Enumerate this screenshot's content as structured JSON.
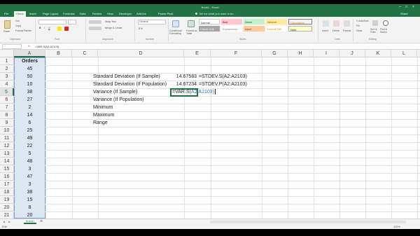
{
  "window": {
    "title": "Book1 - Excel"
  },
  "tabs": [
    "File",
    "Home",
    "Insert",
    "Page Layout",
    "Formulas",
    "Data",
    "Review",
    "View",
    "Developer",
    "Add-ins",
    "Power Pivot"
  ],
  "tell_me": "Tell me what you want to do...",
  "share": "Share",
  "ribbon": {
    "clipboard": {
      "cut": "Cut",
      "copy": "Copy",
      "format_painter": "Format Painter",
      "paste": "Paste",
      "label": "Clipboard"
    },
    "font": {
      "label": "Font"
    },
    "alignment": {
      "wrap": "Wrap Text",
      "merge": "Merge & Center",
      "label": "Alignment"
    },
    "number": {
      "format": "General",
      "label": "Number"
    },
    "styles": {
      "conditional": "Conditional Formatting",
      "format_table": "Format as Table",
      "cells": [
        "Normal",
        "Bad",
        "Good",
        "Neutral",
        "Calculation",
        "Check Cell",
        "Explanatory...",
        "Input",
        "Linked Cell",
        "Note"
      ],
      "label": "Styles"
    },
    "cells": {
      "insert": "Insert",
      "delete": "Delete",
      "format": "Format",
      "label": "Cells"
    },
    "editing": {
      "autosum": "AutoSum",
      "fill": "Fill",
      "clear": "Clear",
      "sort": "Sort & Filter",
      "find": "Find & Select",
      "label": "Editing"
    }
  },
  "formula_bar": {
    "name_box": "",
    "fx": "fx",
    "content": "=VAR.S(A2:A2103)"
  },
  "columns": [
    "A",
    "B",
    "C",
    "D",
    "E",
    "F",
    "G",
    "H",
    "I",
    "J",
    "K",
    "L",
    "M"
  ],
  "rows": [
    "1",
    "2",
    "3",
    "4",
    "5",
    "6",
    "7",
    "8",
    "9",
    "10",
    "11",
    "12",
    "13",
    "14",
    "15",
    "16",
    "17",
    "18",
    "19",
    "20",
    "21"
  ],
  "sheet": {
    "header": "Orders",
    "orders": [
      "45",
      "50",
      "10",
      "38",
      "27",
      "2",
      "14",
      "6",
      "25",
      "49",
      "22",
      "5",
      "48",
      "3",
      "47",
      "3",
      "38",
      "15",
      "8",
      "20"
    ],
    "labels": [
      "Standard Deviation (If Sample)",
      "Standard Deviation (If Population)",
      "Variance (If Sample)",
      "Variance (If Population)",
      "Minimum",
      "Maximum",
      "Range"
    ],
    "values": [
      "14.67583",
      "14.67234"
    ],
    "formulas": [
      "=STDEV.S(A2:A2103)",
      "=STDEV.P(A2:A2103)"
    ],
    "editing": {
      "fn": "=VAR.S(",
      "ref": "A2:A2103)"
    }
  },
  "sheet_tabs": [
    "Sheet1"
  ],
  "status": {
    "ready": "Edit",
    "zoom": "100%"
  }
}
